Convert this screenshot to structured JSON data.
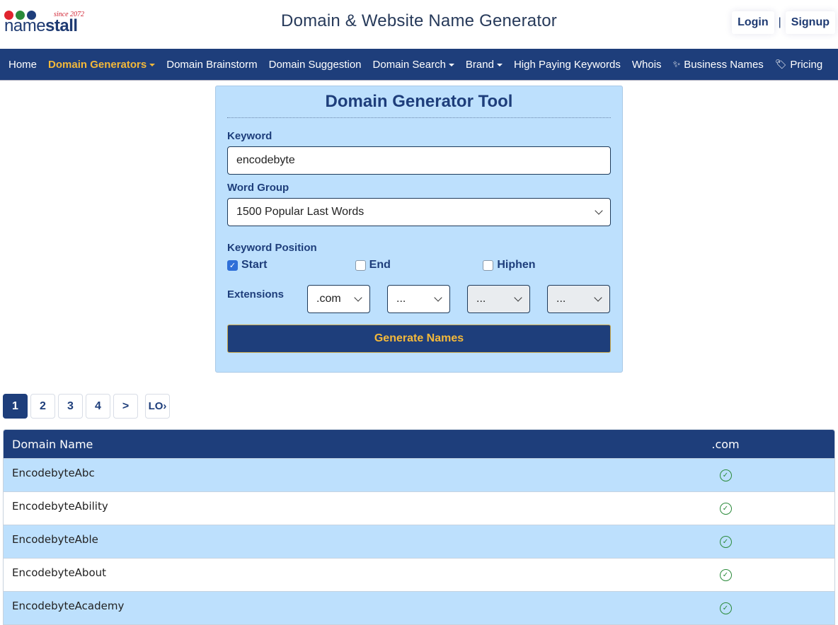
{
  "brand": {
    "since": "since 2072",
    "name_light": "name",
    "name_bold": "stall",
    "dot_colors": [
      "#e0242e",
      "#2a8a3a",
      "#1e3e7b"
    ]
  },
  "header": {
    "title": "Domain & Website Name Generator",
    "login": "Login",
    "separator": "|",
    "signup": "Signup"
  },
  "nav": {
    "items": [
      {
        "label": "Home",
        "dropdown": false
      },
      {
        "label": "Domain Generators",
        "dropdown": true,
        "active": true
      },
      {
        "label": "Domain Brainstorm",
        "dropdown": false
      },
      {
        "label": "Domain Suggestion",
        "dropdown": false
      },
      {
        "label": "Domain Search",
        "dropdown": true
      },
      {
        "label": "Brand",
        "dropdown": true
      },
      {
        "label": "High Paying Keywords",
        "dropdown": false
      },
      {
        "label": "Whois",
        "dropdown": false
      },
      {
        "label": "Business Names",
        "icon": "sparkles-icon"
      },
      {
        "label": "Pricing",
        "icon": "tag-icon"
      }
    ]
  },
  "tool": {
    "title": "Domain Generator Tool",
    "keyword_label": "Keyword",
    "keyword_value": "encodebyte",
    "word_group_label": "Word Group",
    "word_group_value": "1500 Popular Last Words",
    "position_label": "Keyword Position",
    "positions": [
      {
        "label": "Start",
        "checked": true
      },
      {
        "label": "End",
        "checked": false
      },
      {
        "label": "Hiphen",
        "checked": false
      }
    ],
    "extensions_label": "Extensions",
    "extensions": [
      {
        "value": ".com",
        "disabled": false
      },
      {
        "value": "...",
        "disabled": false
      },
      {
        "value": "...",
        "disabled": true
      },
      {
        "value": "...",
        "disabled": true
      }
    ],
    "generate_label": "Generate Names"
  },
  "pagination": {
    "pages": [
      "1",
      "2",
      "3",
      "4"
    ],
    "current": "1",
    "next": ">",
    "last": "LO›"
  },
  "results": {
    "columns": [
      "Domain Name",
      ".com"
    ],
    "rows": [
      {
        "name": "EncodebyteAbc",
        "com": "available"
      },
      {
        "name": "EncodebyteAbility",
        "com": "available"
      },
      {
        "name": "EncodebyteAble",
        "com": "available"
      },
      {
        "name": "EncodebyteAbout",
        "com": "available"
      },
      {
        "name": "EncodebyteAcademy",
        "com": "available"
      }
    ]
  }
}
